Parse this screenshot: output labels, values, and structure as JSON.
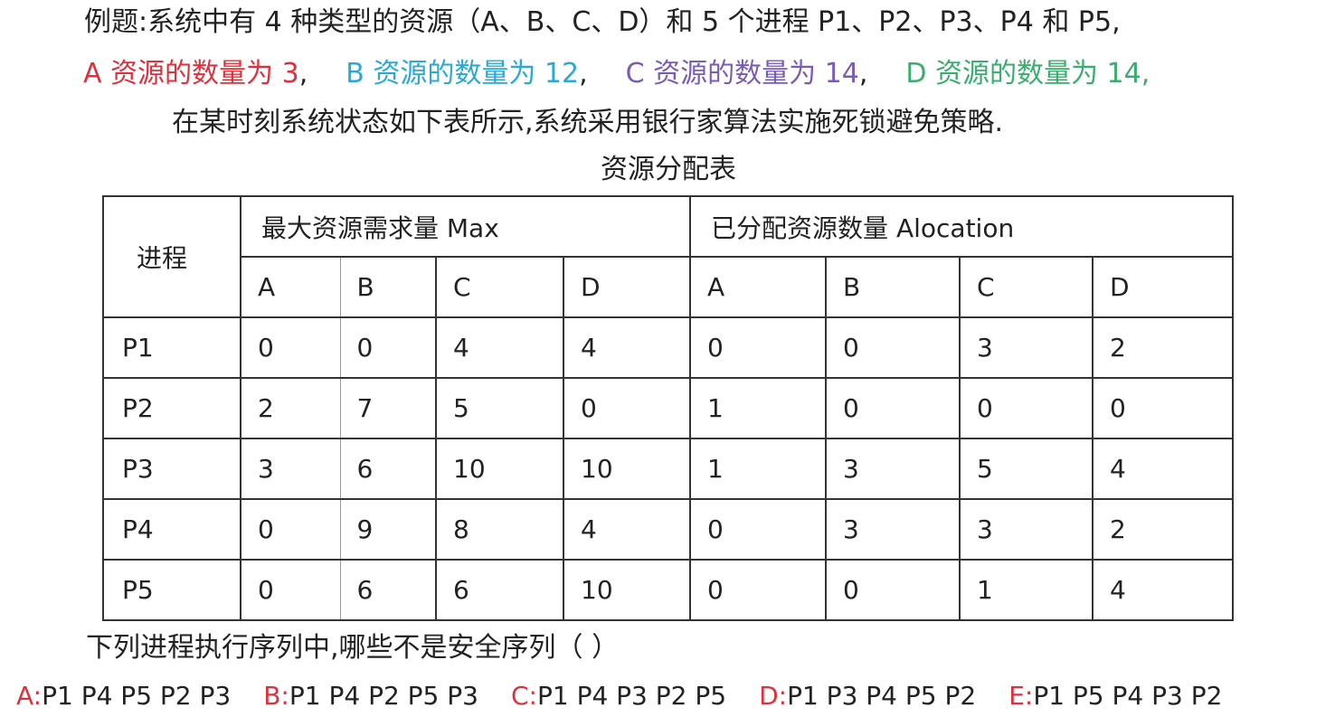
{
  "intro_line1": "例题:系统中有 4 种类型的资源（A、B、C、D）和 5 个进程 P1、P2、P3、P4 和 P5,",
  "resource_counts": [
    {
      "text": "A 资源的数量为 3",
      "sep": ",",
      "color": "#e0303b"
    },
    {
      "text": "B 资源的数量为 12",
      "sep": ",",
      "color": "#2aa9d6"
    },
    {
      "text": "C 资源的数量为 14",
      "sep": ",",
      "color": "#7a5cb8"
    },
    {
      "text": "D 资源的数量为 14",
      "sep": ",",
      "color": "#3aae6e"
    }
  ],
  "intro_line3": "在某时刻系统状态如下表所示,系统采用银行家算法实施死锁避免策略.",
  "table_title": "资源分配表",
  "table": {
    "process_header": "进程",
    "max_header": "最大资源需求量 Max",
    "alloc_header": "已分配资源数量 Alocation",
    "resource_headers": [
      "A",
      "B",
      "C",
      "D"
    ],
    "rows": [
      {
        "process": "P1",
        "max": [
          "0",
          "0",
          "4",
          "4"
        ],
        "alloc": [
          "0",
          "0",
          "3",
          "2"
        ]
      },
      {
        "process": "P2",
        "max": [
          "2",
          "7",
          "5",
          "0"
        ],
        "alloc": [
          "1",
          "0",
          "0",
          "0"
        ]
      },
      {
        "process": "P3",
        "max": [
          "3",
          "6",
          "10",
          "10"
        ],
        "alloc": [
          "1",
          "3",
          "5",
          "4"
        ]
      },
      {
        "process": "P4",
        "max": [
          "0",
          "9",
          "8",
          "4"
        ],
        "alloc": [
          "0",
          "3",
          "3",
          "2"
        ]
      },
      {
        "process": "P5",
        "max": [
          "0",
          "6",
          "6",
          "10"
        ],
        "alloc": [
          "0",
          "0",
          "1",
          "4"
        ]
      }
    ]
  },
  "question": "下列进程执行序列中,哪些不是安全序列（      ）",
  "options": [
    {
      "letter": "A:",
      "sequence": "P1 P4 P5 P2 P3"
    },
    {
      "letter": "B:",
      "sequence": "P1 P4 P2 P5 P3"
    },
    {
      "letter": "C:",
      "sequence": "P1 P4 P3 P2 P5"
    },
    {
      "letter": "D:",
      "sequence": "P1 P3 P4 P5 P2"
    },
    {
      "letter": "E:",
      "sequence": "P1 P5 P4 P3 P2"
    }
  ],
  "option_letter_color": "#e0303b"
}
